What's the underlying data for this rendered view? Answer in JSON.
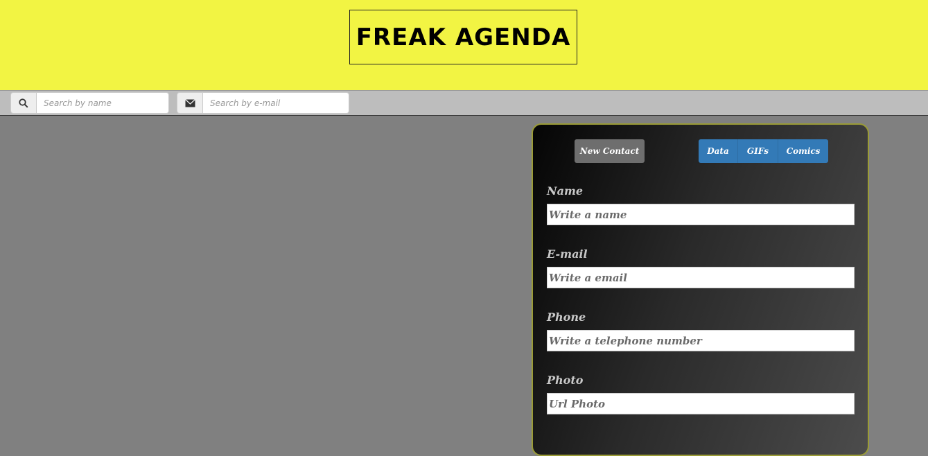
{
  "header": {
    "title": "Freak Agenda"
  },
  "search": {
    "name_placeholder": "Search by name",
    "email_placeholder": "Search by e-mail"
  },
  "panel": {
    "new_contact_label": "New Contact",
    "tabs": [
      {
        "label": "Data"
      },
      {
        "label": "GIFs"
      },
      {
        "label": "Comics"
      }
    ],
    "fields": [
      {
        "label": "Name",
        "placeholder": "Write a name"
      },
      {
        "label": "E-mail",
        "placeholder": "Write a email"
      },
      {
        "label": "Phone",
        "placeholder": "Write a telephone number"
      },
      {
        "label": "Photo",
        "placeholder": "Url Photo"
      }
    ]
  },
  "colors": {
    "header_bg": "#f2f443",
    "page_bg": "#808080",
    "tab_blue": "#337ab7",
    "panel_border": "#9a9b36"
  },
  "icons": [
    "search-icon",
    "envelope-icon"
  ]
}
